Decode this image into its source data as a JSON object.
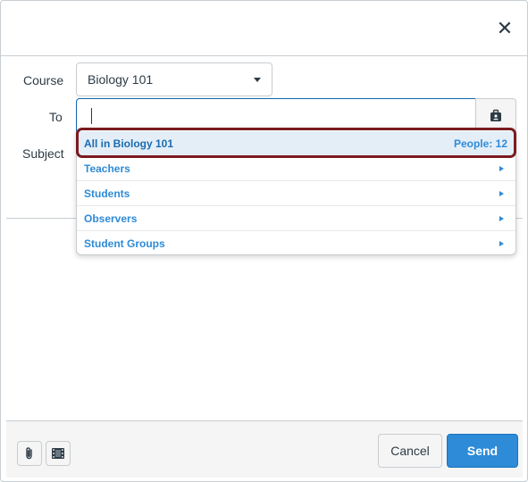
{
  "dialog": {
    "close_icon": "close-icon"
  },
  "form": {
    "course_label": "Course",
    "course_value": "Biology 101",
    "to_label": "To",
    "subject_label": "Subject"
  },
  "recipients": {
    "selected": {
      "label": "All in Biology 101",
      "count": "People: 12"
    },
    "items": [
      {
        "label": "Teachers"
      },
      {
        "label": "Students"
      },
      {
        "label": "Observers"
      },
      {
        "label": "Student Groups"
      }
    ]
  },
  "footer": {
    "attach_icon": "paperclip-icon",
    "media_icon": "media-icon",
    "cancel_label": "Cancel",
    "send_label": "Send"
  },
  "colors": {
    "accent": "#2d8bd7",
    "highlight": "#7b1b1f"
  }
}
